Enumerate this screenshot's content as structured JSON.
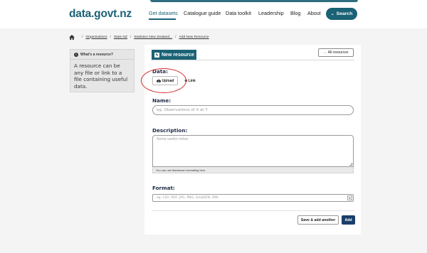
{
  "header": {
    "logo": "data.govt.nz",
    "nav": [
      {
        "label": "Get datasets",
        "active": true
      },
      {
        "label": "Catalogue guide"
      },
      {
        "label": "Data toolkit"
      },
      {
        "label": "Leadership"
      },
      {
        "label": "Blog"
      },
      {
        "label": "About"
      }
    ],
    "search_label": "Search"
  },
  "breadcrumb": {
    "items": [
      "Organisations",
      "Stats NZ",
      "Statistics New Zealand...",
      "Add New Resource"
    ],
    "separator": "/"
  },
  "sidebar": {
    "heading": "What's a resource?",
    "body": "A resource can be any file or link to a file containing useful data."
  },
  "form": {
    "tab_label": "New resource",
    "all_resources": "← All resources",
    "data_label": "Data:",
    "upload_label": "Upload",
    "link_label": "Link",
    "name_label": "Name:",
    "name_placeholder": "eg. Observations of X at Y",
    "description_label": "Description:",
    "description_placeholder": "Some useful notes",
    "markdown_hint": "You can use Markdown formatting here",
    "format_label": "Format:",
    "format_placeholder": "eg. CSV, PDF, JPG, PNG, GeoJSON, XML",
    "save_add_label": "Save & add another",
    "add_label": "Add"
  },
  "colors": {
    "brand": "#1a6275",
    "annotation": "#d42a2a",
    "primary_button": "#1a3f6a"
  }
}
